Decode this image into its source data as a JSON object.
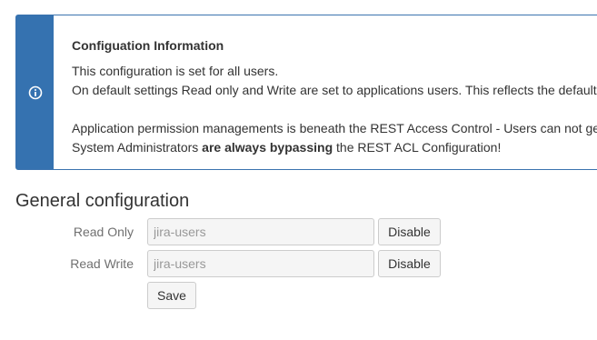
{
  "info": {
    "icon": "info-circle-icon",
    "title": "Configuation Information",
    "line1": "This configuration is set for all users.",
    "line2": "On default settings Read only and Write are set to applications users. This reflects the default",
    "line3": "Application permission managements is beneath the REST Access Control - Users can not ge",
    "line4_prefix": "System Administrators ",
    "line4_bold": "are always bypassing",
    "line4_suffix": " the REST ACL Configuration!",
    "colors": {
      "stripe": "#3572b0",
      "border": "#3b73af"
    }
  },
  "general": {
    "title": "General configuration",
    "read_only": {
      "label": "Read Only",
      "value": "jira-users",
      "button": "Disable"
    },
    "read_write": {
      "label": "Read Write",
      "value": "jira-users",
      "button": "Disable"
    },
    "save_label": "Save"
  }
}
